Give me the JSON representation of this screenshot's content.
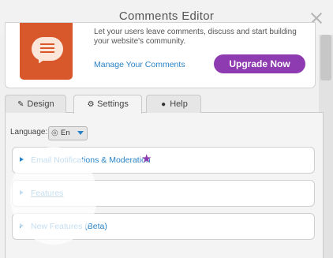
{
  "dialog": {
    "title": "Comments Editor"
  },
  "promo": {
    "description": "Let your users leave comments, discuss and start building your website's community.",
    "manage_link": "Manage Your Comments",
    "upgrade_label": "Upgrade Now"
  },
  "tabs": [
    {
      "label": "Design",
      "icon": "brush-icon",
      "active": false
    },
    {
      "label": "Settings",
      "icon": "gear-icon",
      "active": true
    },
    {
      "label": "Help",
      "icon": "user-icon",
      "active": false
    }
  ],
  "language": {
    "label": "Language:",
    "value": "En"
  },
  "sections": [
    {
      "label": "Email Notifications & Moderation",
      "badge": "★"
    },
    {
      "label": "Features"
    },
    {
      "label": "New Features (Beta)"
    }
  ],
  "colors": {
    "accent": "#2a83c6",
    "brand_purple": "#8e3ab0",
    "app_icon": "#d8582b"
  }
}
